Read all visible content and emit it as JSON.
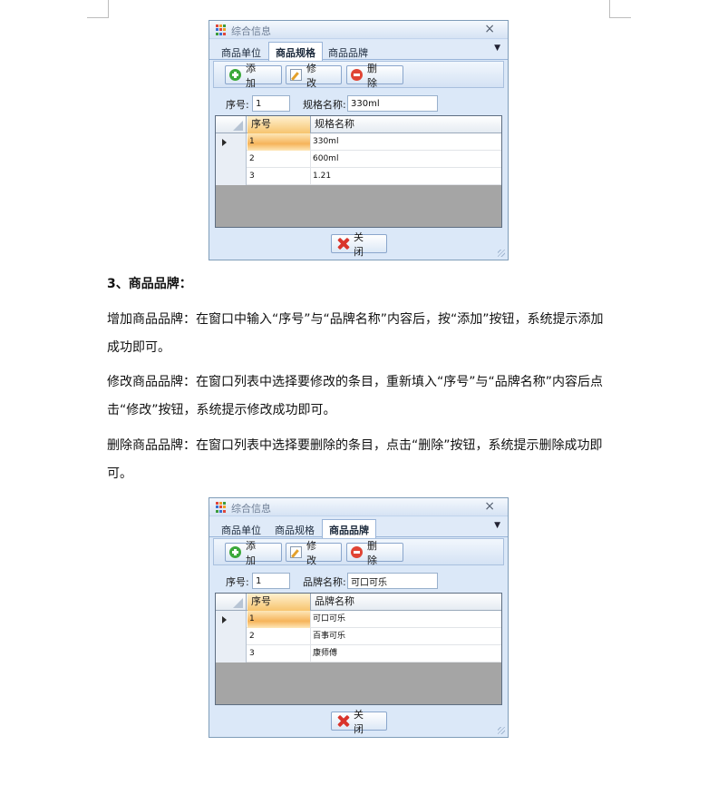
{
  "window_title": "综合信息",
  "tabs": [
    "商品单位",
    "商品规格",
    "商品品牌"
  ],
  "toolbar": {
    "add": "添 加",
    "edit": "修 改",
    "delete": "删 除"
  },
  "close_label": "关 闭",
  "icon_names": {
    "close": "close-x-icon",
    "dropdown": "chevron-down-icon",
    "add": "add-circle-icon",
    "edit": "pencil-edit-icon",
    "delete": "delete-circle-icon",
    "close_button": "red-cross-icon"
  },
  "colors": {
    "selected_cell": "#f6b45a",
    "grid_empty": "#a5a5a5",
    "panel_bg": "#dbe8f8"
  },
  "windows": [
    {
      "active_tab": "商品规格",
      "seq_label": "序号:",
      "seq_value": "1",
      "name_label": "规格名称:",
      "name_value": "330ml",
      "columns": [
        "序号",
        "规格名称"
      ],
      "rows": [
        {
          "seq": "1",
          "name": "330ml"
        },
        {
          "seq": "2",
          "name": "600ml"
        },
        {
          "seq": "3",
          "name": "1.21"
        }
      ]
    },
    {
      "active_tab": "商品品牌",
      "seq_label": "序号:",
      "seq_value": "1",
      "name_label": "品牌名称:",
      "name_value": "可口可乐",
      "columns": [
        "序号",
        "品牌名称"
      ],
      "rows": [
        {
          "seq": "1",
          "name": "可口可乐"
        },
        {
          "seq": "2",
          "name": "百事可乐"
        },
        {
          "seq": "3",
          "name": "康师傅"
        }
      ]
    }
  ],
  "doc": {
    "heading": "3、商品品牌：",
    "paragraphs": [
      "增加商品品牌：在窗口中输入“序号”与“品牌名称”内容后，按“添加”按钮，系统提示添加成功即可。",
      "修改商品品牌：在窗口列表中选择要修改的条目，重新填入“序号”与“品牌名称”内容后点击“修改”按钮，系统提示修改成功即可。",
      "删除商品品牌：在窗口列表中选择要删除的条目，点击“删除”按钮，系统提示删除成功即可。"
    ]
  }
}
